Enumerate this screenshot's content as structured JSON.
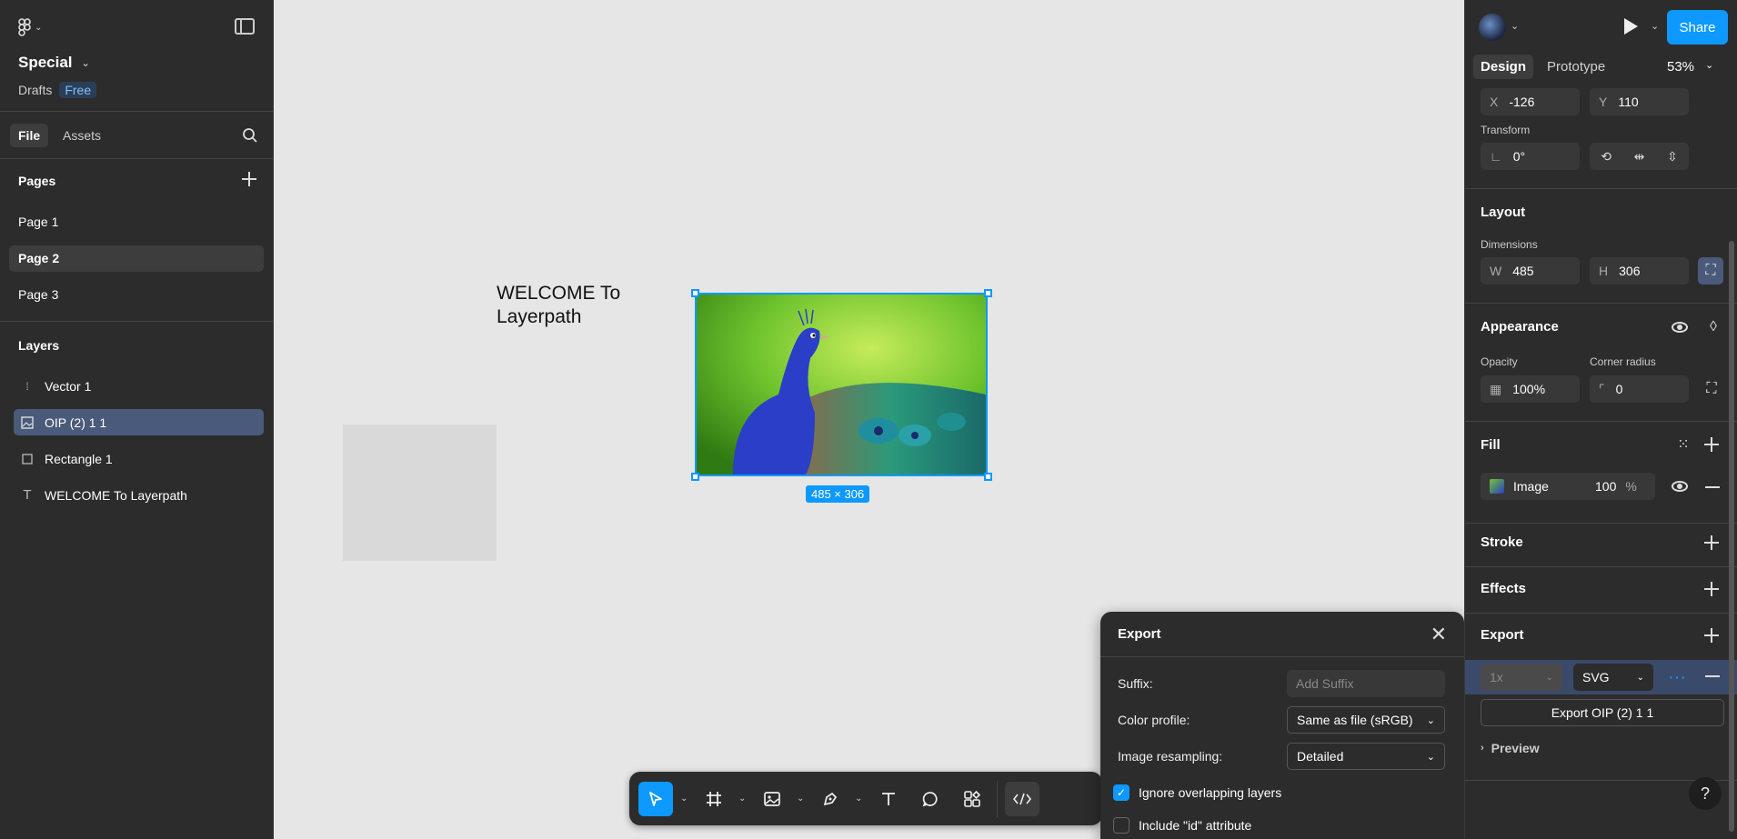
{
  "left_panel": {
    "file_name": "Special",
    "drafts_label": "Drafts",
    "plan_badge": "Free",
    "tabs": [
      "File",
      "Assets"
    ],
    "pages_header": "Pages",
    "pages": [
      "Page 1",
      "Page 2",
      "Page 3"
    ],
    "active_page": "Page 2",
    "layers_header": "Layers",
    "layers": [
      {
        "name": "Vector 1",
        "icon": "vector-icon"
      },
      {
        "name": "OIP (2) 1 1",
        "icon": "image-icon"
      },
      {
        "name": "Rectangle 1",
        "icon": "rectangle-icon"
      },
      {
        "name": "WELCOME To Layerpath",
        "icon": "text-icon"
      }
    ]
  },
  "canvas": {
    "welcome_text": "WELCOME To Layerpath",
    "selection_size": "485 × 306"
  },
  "export_modal": {
    "title": "Export",
    "suffix_label": "Suffix:",
    "suffix_placeholder": "Add Suffix",
    "color_profile_label": "Color profile:",
    "color_profile_value": "Same as file (sRGB)",
    "resampling_label": "Image resampling:",
    "resampling_value": "Detailed",
    "ignore_overlapping_label": "Ignore overlapping layers",
    "ignore_overlapping_checked": true,
    "include_id_label": "Include \"id\" attribute",
    "include_id_checked": false
  },
  "right_panel": {
    "share_label": "Share",
    "tabs": [
      "Design",
      "Prototype"
    ],
    "zoom": "53%",
    "x_label": "X",
    "x_value": "-126",
    "y_label": "Y",
    "y_value": "110",
    "transform_label": "Transform",
    "rotation_value": "0°",
    "layout_title": "Layout",
    "dimensions_label": "Dimensions",
    "w_label": "W",
    "w_value": "485",
    "h_label": "H",
    "h_value": "306",
    "appearance_title": "Appearance",
    "opacity_label": "Opacity",
    "opacity_value": "100%",
    "corner_radius_label": "Corner radius",
    "corner_radius_value": "0",
    "fill_title": "Fill",
    "fill_type": "Image",
    "fill_opacity": "100",
    "fill_percent": "%",
    "stroke_title": "Stroke",
    "effects_title": "Effects",
    "export_title": "Export",
    "export_scale": "1x",
    "export_format": "SVG",
    "export_button": "Export OIP (2) 1 1",
    "preview_label": "Preview",
    "help_label": "?"
  },
  "colors": {
    "accent": "#0d99ff",
    "panel_bg": "#2c2c2c",
    "canvas_bg": "#e6e6e6"
  }
}
